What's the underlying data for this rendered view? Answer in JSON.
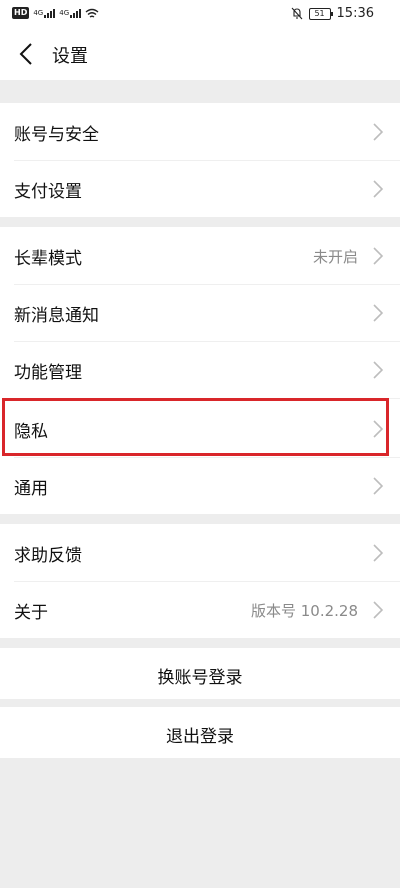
{
  "status_bar": {
    "hd_label": "HD",
    "signal_1": "4G",
    "signal_2": "4G",
    "battery": "51",
    "time": "15:36"
  },
  "nav": {
    "title": "设置"
  },
  "groups": {
    "account": [
      {
        "label": "账号与安全",
        "value": ""
      },
      {
        "label": "支付设置",
        "value": ""
      }
    ],
    "general": [
      {
        "label": "长辈模式",
        "value": "未开启"
      },
      {
        "label": "新消息通知",
        "value": ""
      },
      {
        "label": "功能管理",
        "value": ""
      },
      {
        "label": "隐私",
        "value": ""
      },
      {
        "label": "通用",
        "value": ""
      }
    ],
    "support": [
      {
        "label": "求助反馈",
        "value": ""
      },
      {
        "label": "关于",
        "value": "版本号 10.2.28"
      }
    ]
  },
  "actions": {
    "switch_account": "换账号登录",
    "logout": "退出登录"
  },
  "colors": {
    "background": "#ededed",
    "highlight": "#d9262a"
  }
}
